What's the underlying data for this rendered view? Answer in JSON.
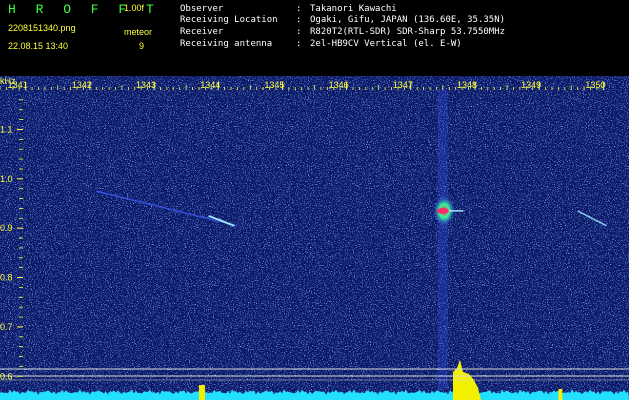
{
  "header": {
    "brand": "H R O F F T",
    "version": "1.00f",
    "filename": "2208151340.png",
    "mode": "meteor",
    "datetime": "22.08.15 13:40",
    "count": "9"
  },
  "info": {
    "observer_label": "Observer",
    "observer_value": "Takanori Kawachi",
    "location_label": "Receiving Location",
    "location_value": "Ogaki, Gifu, JAPAN (136.60E, 35.35N)",
    "receiver_label": "Receiver",
    "receiver_value": "R820T2(RTL-SDR) SDR-Sharp 53.7550MHz",
    "antenna_label": "Receiving antenna",
    "antenna_value": "2el-HB9CV Vertical (el. E-W)",
    "separator": ":"
  },
  "chart_data": {
    "type": "heatmap",
    "ylabel": "kHz",
    "x_ticks": [
      "1341",
      "1342",
      "1343",
      "1344",
      "1345",
      "1346",
      "1347",
      "1348",
      "1349",
      "1350"
    ],
    "y_ticks": [
      "1.1",
      "1.0",
      "0.9",
      "0.8",
      "0.7",
      "0.6"
    ],
    "xlim": [
      1340.6,
      1350.4
    ],
    "ylim": [
      0.56,
      1.18
    ],
    "colors": {
      "background": "#0a1a66",
      "noise": "#3c5cff",
      "trail": "#a0e8ff",
      "hot": "#ff2b6a",
      "warm": "#30ff90",
      "level": "#22e0ff",
      "level_peak": "#f0f000",
      "marker_line": "#dcdcdc",
      "axis_text": "#ffff3c"
    }
  }
}
